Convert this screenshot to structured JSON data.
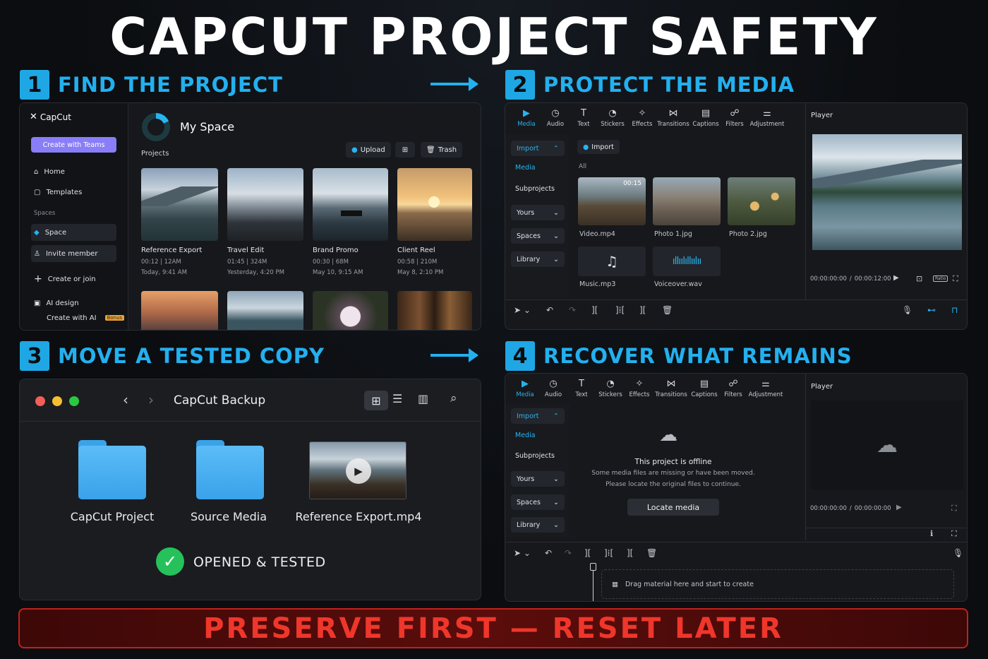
{
  "title": "CAPCUT PROJECT SAFETY",
  "steps": [
    {
      "num": "1",
      "title": "FIND THE PROJECT"
    },
    {
      "num": "2",
      "title": "PROTECT THE MEDIA"
    },
    {
      "num": "3",
      "title": "MOVE A TESTED COPY"
    },
    {
      "num": "4",
      "title": "RECOVER WHAT REMAINS"
    }
  ],
  "home": {
    "brand": "CapCut",
    "create_teams": "Create with Teams",
    "nav": [
      "Home",
      "Templates"
    ],
    "spaces_label": "Spaces",
    "space": "Space",
    "invite": "Invite member",
    "create_join": "Create or join",
    "ai_design": "AI design",
    "create_ai": "Create with AI",
    "bonus": "Bonus",
    "workspace": "My Space",
    "projects_label": "Projects",
    "upload": "Upload",
    "trash": "Trash",
    "projects": [
      {
        "name": "Reference Export",
        "meta1": "00:12  |  12AM",
        "meta2": "Today, 9:41 AM"
      },
      {
        "name": "Travel Edit",
        "meta1": "01:45  |  324M",
        "meta2": "Yesterday, 4:20 PM"
      },
      {
        "name": "Brand Promo",
        "meta1": "00:30  |  68M",
        "meta2": "May 10, 9:15 AM"
      },
      {
        "name": "Client Reel",
        "meta1": "00:58  |  210M",
        "meta2": "May 8, 2:10 PM"
      }
    ]
  },
  "editor": {
    "toolbar": [
      "Media",
      "Audio",
      "Text",
      "Stickers",
      "Effects",
      "Transitions",
      "Captions",
      "Filters",
      "Adjustment"
    ],
    "import": "Import",
    "media": "Media",
    "subprojects": "Subprojects",
    "yours": "Yours",
    "spaces": "Spaces",
    "library": "Library",
    "all": "All",
    "import_btn": "Import",
    "duration": "00:15",
    "files": [
      "Video.mp4",
      "Photo 1.jpg",
      "Photo 2.jpg",
      "Music.mp3",
      "Voiceover.wav"
    ],
    "player": "Player",
    "time1": "00:00:00:00",
    "time_sep": "/",
    "time2": "00:00:12:00",
    "ratio": "Ratio"
  },
  "finder": {
    "title": "CapCut Backup",
    "items": [
      "CapCut Project",
      "Source Media",
      "Reference Export.mp4"
    ],
    "status": "OPENED & TESTED"
  },
  "recover": {
    "offline_title": "This project is offline",
    "offline_line1": "Some media files are missing or have been moved.",
    "offline_line2": "Please locate the original files to continue.",
    "locate": "Locate media",
    "player": "Player",
    "time1": "00:00:00:00",
    "time_sep": "/",
    "time2": "00:00:00:00",
    "drag": "Drag material here and start to create"
  },
  "footer": "PRESERVE FIRST — RESET LATER",
  "colors": {
    "accent": "#23b0ef",
    "purple": "#8a7df8",
    "danger": "#f0362b",
    "success": "#26c15a"
  }
}
